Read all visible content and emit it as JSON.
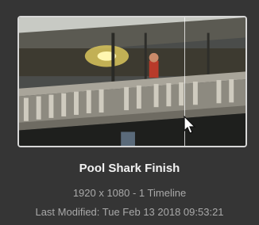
{
  "project": {
    "title": "Pool Shark Finish",
    "resolution_info": "1920 x 1080 - 1 Timeline",
    "last_modified": "Last Modified: Tue Feb 13 2018 09:53:21"
  },
  "thumbnail": {
    "icon": "project-thumbnail-image",
    "accent_border": "#d8d8d8"
  },
  "cursor": {
    "icon": "mouse-pointer-icon"
  }
}
